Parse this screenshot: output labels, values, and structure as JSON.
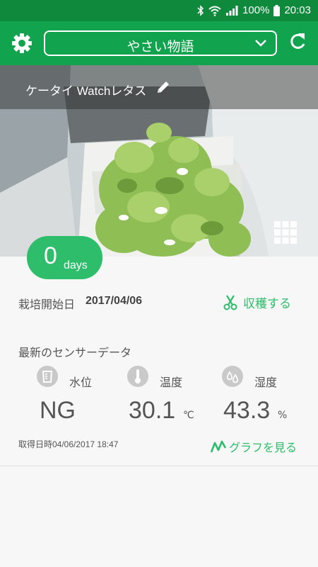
{
  "status_bar": {
    "battery": "100%",
    "time": "20:03"
  },
  "header": {
    "title": "やさい物語"
  },
  "photo": {
    "plant_name": "ケータイ Watchレタス"
  },
  "days_badge": {
    "count": "0",
    "unit": "days"
  },
  "cultivation": {
    "start_label": "栽培開始日",
    "start_date": "2017/04/06",
    "harvest_label": "収穫する"
  },
  "sensors": {
    "title": "最新のセンサーデータ",
    "water": {
      "label": "水位",
      "value": "NG"
    },
    "temperature": {
      "label": "温度",
      "value": "30.1",
      "unit": "℃"
    },
    "humidity": {
      "label": "湿度",
      "value": "43.3",
      "unit": "%"
    },
    "timestamp": "取得日時04/06/2017 18:47",
    "graph_label": "グラフを見る"
  },
  "colors": {
    "status_bar": "#0f8a3c",
    "app_bar": "#12a34e",
    "accent": "#2ebd6a"
  }
}
